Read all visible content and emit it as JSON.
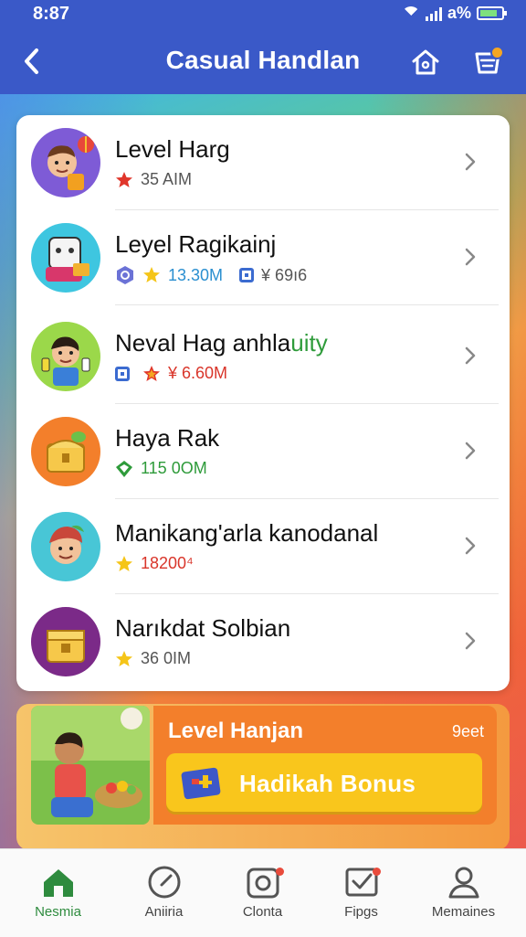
{
  "status": {
    "time": "8:87",
    "battery": "a%"
  },
  "header": {
    "title": "Casual Handlan",
    "back_icon": "chevron-left-icon",
    "home_icon": "home-icon",
    "inbox_icon": "inbox-icon",
    "accent": "#3a59c8"
  },
  "list": [
    {
      "name": "Level Harg",
      "meta": [
        {
          "icon": "star-red-icon",
          "text": "35 AIM",
          "color": "#555555"
        }
      ]
    },
    {
      "name": "Leyel Ragikainj",
      "meta": [
        {
          "icon": "badge-icon",
          "text": ""
        },
        {
          "icon": "star-yellow-icon",
          "text": "13.30M",
          "color": "#2a8fd0"
        },
        {
          "icon": "square-icon",
          "text": "¥ 69ı6",
          "color": "#555555"
        }
      ]
    },
    {
      "name_parts": [
        "Neval Hag anhla",
        "uity"
      ],
      "meta": [
        {
          "icon": "square-icon",
          "text": ""
        },
        {
          "icon": "star-red-icon",
          "text": "¥ 6.60M",
          "color": "#d9352a"
        }
      ]
    },
    {
      "name": "Haya Rak",
      "meta": [
        {
          "icon": "gem-green-icon",
          "text": "115 0OM",
          "color": "#2e9b3a"
        }
      ]
    },
    {
      "name": "Manikang'arla kanodanal",
      "meta": [
        {
          "icon": "star-yellow-icon",
          "text": "18200⁴",
          "color": "#d9352a"
        }
      ]
    },
    {
      "name": "Narıkdat Solbian",
      "meta": [
        {
          "icon": "star-yellow-icon",
          "text": "36 0IM",
          "color": "#555555"
        }
      ]
    }
  ],
  "promo": {
    "title": "Level Hanjan",
    "tag": "9eet",
    "button_label": "Hadikah Bonus"
  },
  "nav": [
    {
      "label": "Nesmia",
      "icon": "home-icon",
      "active": true
    },
    {
      "label": "Aniiria",
      "icon": "compass-icon",
      "active": false
    },
    {
      "label": "Clonta",
      "icon": "camera-icon",
      "active": false
    },
    {
      "label": "Fipgs",
      "icon": "mail-check-icon",
      "active": false
    },
    {
      "label": "Memaines",
      "icon": "profile-icon",
      "active": false
    }
  ]
}
